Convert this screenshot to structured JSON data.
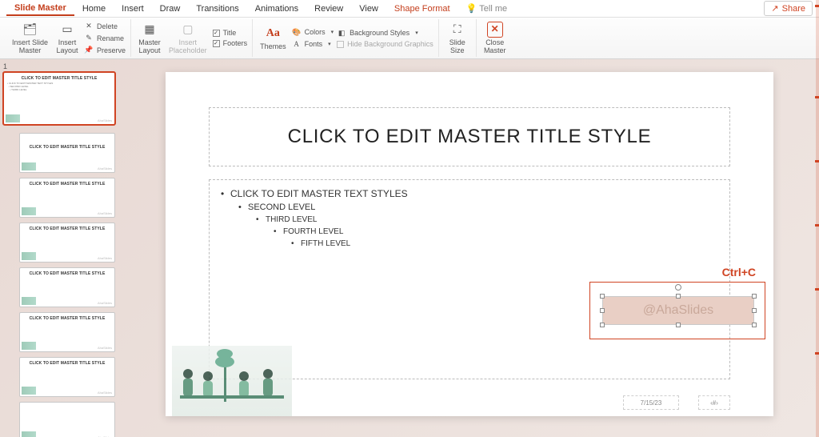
{
  "tabs": {
    "items": [
      "Slide Master",
      "Home",
      "Insert",
      "Draw",
      "Transitions",
      "Animations",
      "Review",
      "View",
      "Shape Format"
    ],
    "active": "Slide Master",
    "extra_red": "Shape Format",
    "tellme": "Tell me",
    "share": "Share"
  },
  "ribbon": {
    "insert_slide_master": "Insert Slide\nMaster",
    "insert_layout": "Insert\nLayout",
    "delete": "Delete",
    "rename": "Rename",
    "preserve": "Preserve",
    "master_layout": "Master\nLayout",
    "insert_placeholder": "Insert\nPlaceholder",
    "cb_title": "Title",
    "cb_footers": "Footers",
    "themes": "Themes",
    "colors": "Colors",
    "fonts": "Fonts",
    "bg_styles": "Background Styles",
    "hide_bg": "Hide Background Graphics",
    "slide_size": "Slide\nSize",
    "close_master": "Close\nMaster"
  },
  "thumbs": {
    "num": "1",
    "master_title": "CLICK TO EDIT MASTER TITLE STYLE",
    "layout_title": "CLICK TO EDIT MASTER TITLE STYLE",
    "brand": "AhaSlides"
  },
  "slide": {
    "title": "CLICK TO EDIT MASTER TITLE STYLE",
    "lvl1": "CLICK TO EDIT MASTER TEXT STYLES",
    "lvl2": "SECOND LEVEL",
    "lvl3": "THIRD LEVEL",
    "lvl4": "FOURTH LEVEL",
    "lvl5": "FIFTH LEVEL",
    "date": "7/15/23",
    "num": "‹#›",
    "watermark": "@AhaSlides"
  },
  "annotation": "Ctrl+C"
}
